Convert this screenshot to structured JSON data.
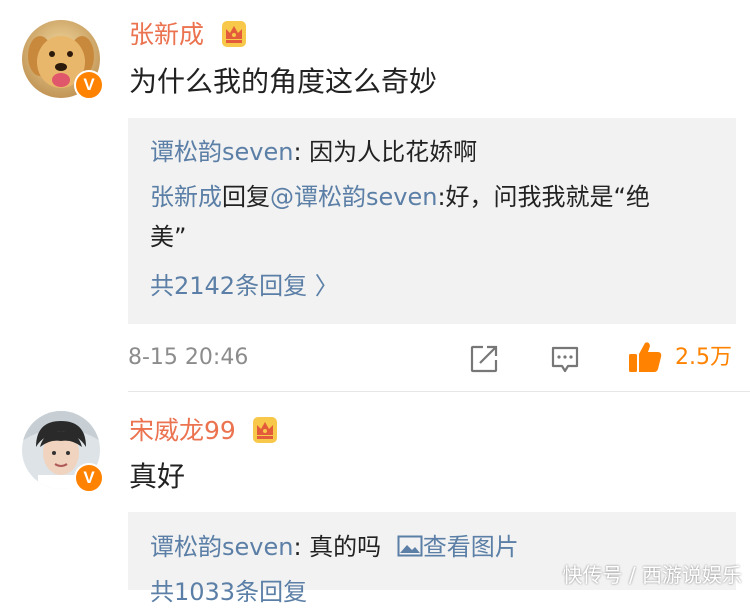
{
  "comments": [
    {
      "username": "张新成",
      "text": "为什么我的角度这么奇妙",
      "replies": [
        {
          "author": "谭松韵seven",
          "separator": ": ",
          "text": "因为人比花娇啊"
        },
        {
          "author": "张新成",
          "action": "回复",
          "mention": "@谭松韵seven",
          "text_line1": ":好，问我我就是“绝",
          "text_line2": "美”"
        }
      ],
      "more_replies": "共2142条回复 〉",
      "timestamp": "8-15 20:46",
      "like_count": "2.5万"
    },
    {
      "username": "宋威龙99",
      "text": "真好",
      "replies": [
        {
          "author": "谭松韵seven",
          "separator": ": ",
          "text": "真的吗",
          "image_link": "查看图片"
        }
      ],
      "more_replies_partial": "共1033条回复"
    }
  ],
  "icons": {
    "verified": "V",
    "verified_badge": "verified-badge-icon",
    "crown": "crown-icon",
    "share": "share-icon",
    "comment": "comment-icon",
    "like": "thumbs-up-icon",
    "image": "image-icon"
  },
  "colors": {
    "username": "#eb7350",
    "link": "#5b7fa6",
    "accent": "#ff8200",
    "reply_bg": "#f2f2f2",
    "meta": "#8c8c8c"
  },
  "watermark": "快传号 / 西游说娱乐"
}
